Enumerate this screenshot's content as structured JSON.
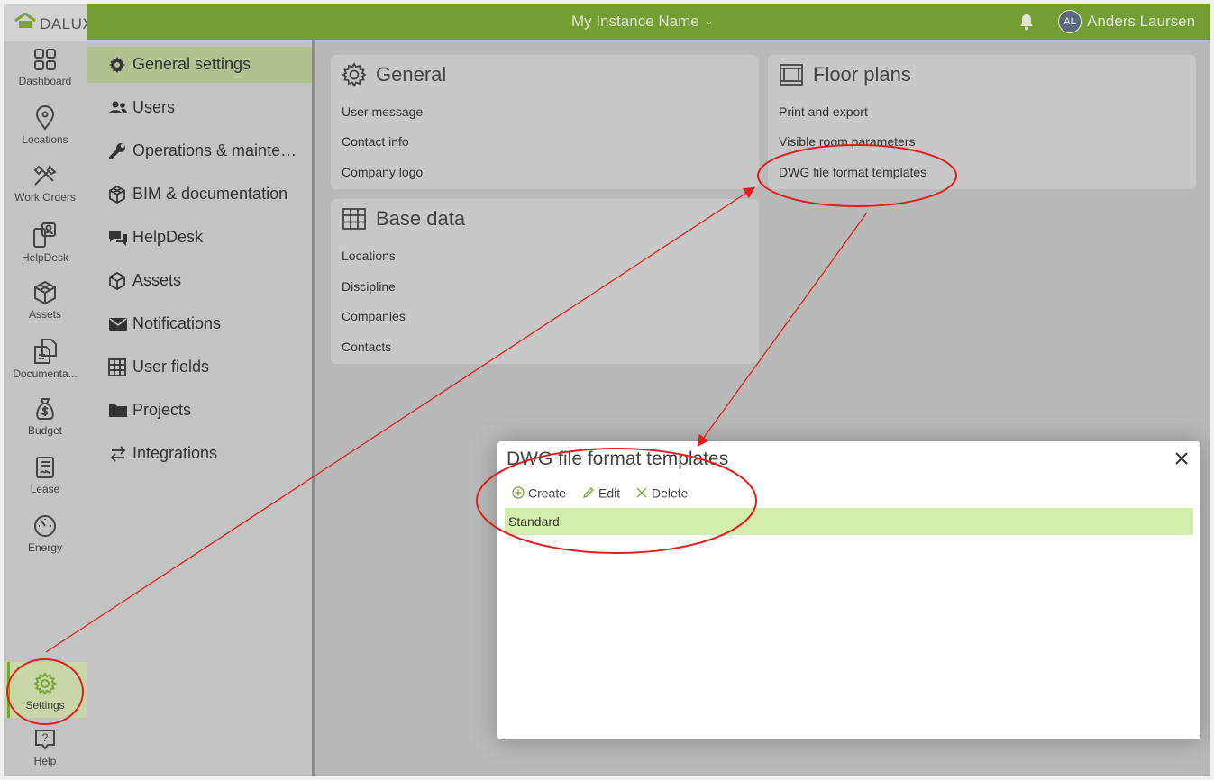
{
  "brand": {
    "name": "DALUX"
  },
  "topbar": {
    "instance_name": "My Instance Name",
    "user_initials": "AL",
    "user_name": "Anders Laursen",
    "color": "#739e33"
  },
  "rail": {
    "items": [
      {
        "label": "Dashboard",
        "icon": "grid-icon"
      },
      {
        "label": "Locations",
        "icon": "map-pin-icon"
      },
      {
        "label": "Work Orders",
        "icon": "tools-icon"
      },
      {
        "label": "HelpDesk",
        "icon": "phone-person-icon"
      },
      {
        "label": "Assets",
        "icon": "cube-icon"
      },
      {
        "label": "Documenta...",
        "icon": "documents-icon"
      },
      {
        "label": "Budget",
        "icon": "money-bag-icon"
      },
      {
        "label": "Lease",
        "icon": "contract-icon"
      },
      {
        "label": "Energy",
        "icon": "gauge-icon"
      }
    ],
    "settings_label": "Settings",
    "help_label": "Help"
  },
  "menu": {
    "items": [
      {
        "label": "General settings",
        "icon": "gear-icon",
        "active": true
      },
      {
        "label": "Users",
        "icon": "users-icon"
      },
      {
        "label": "Operations & mainten...",
        "icon": "wrench-icon"
      },
      {
        "label": "BIM & documentation",
        "icon": "cube-icon"
      },
      {
        "label": "HelpDesk",
        "icon": "chat-icon"
      },
      {
        "label": "Assets",
        "icon": "box-icon"
      },
      {
        "label": "Notifications",
        "icon": "envelope-icon"
      },
      {
        "label": "User fields",
        "icon": "table-icon"
      },
      {
        "label": "Projects",
        "icon": "folder-icon"
      },
      {
        "label": "Integrations",
        "icon": "arrows-icon"
      }
    ]
  },
  "cards": {
    "general": {
      "title": "General",
      "links": [
        "User message",
        "Contact info",
        "Company logo"
      ]
    },
    "floorplans": {
      "title": "Floor plans",
      "links": [
        "Print and export",
        "Visible room parameters",
        "DWG file format templates"
      ]
    },
    "basedata": {
      "title": "Base data",
      "links": [
        "Locations",
        "Discipline",
        "Companies",
        "Contacts"
      ]
    }
  },
  "dialog": {
    "title": "DWG file format templates",
    "toolbar": {
      "create": "Create",
      "edit": "Edit",
      "delete": "Delete"
    },
    "rows": [
      "Standard"
    ],
    "selected_row_color": "#d4edaa"
  },
  "colors": {
    "accent_green": "#739e33",
    "annotation_red": "#e02020"
  }
}
